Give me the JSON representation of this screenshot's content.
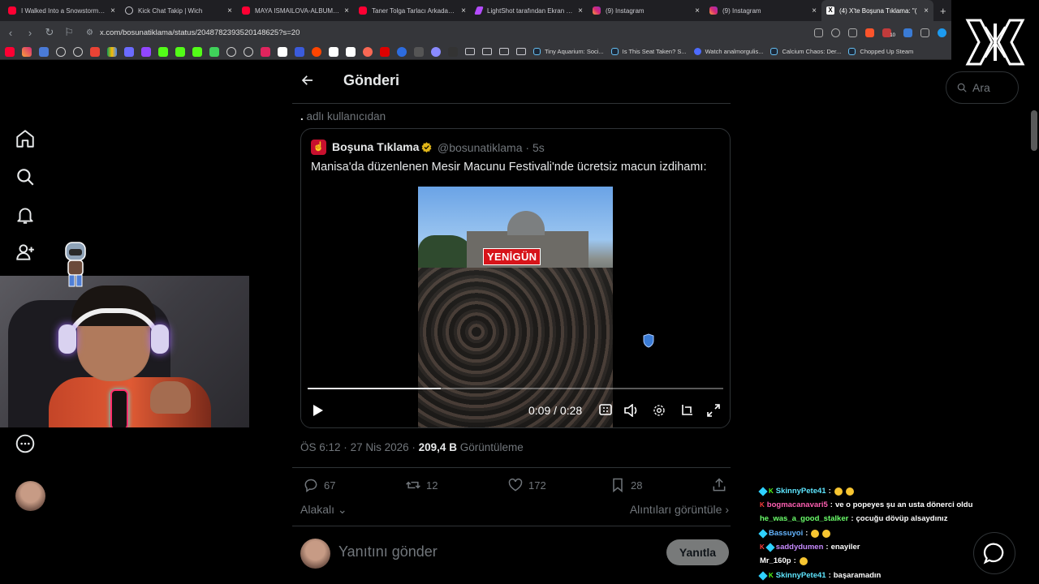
{
  "browser": {
    "tabs": [
      {
        "title": "I Walked Into a Snowstorm Wi",
        "icon": "youtube-icon"
      },
      {
        "title": "Kick Chat Takip | Wich",
        "icon": "globe-icon"
      },
      {
        "title": "MAYA ISMAILOVA-ALBUM \"TAI",
        "icon": "youtube-icon"
      },
      {
        "title": "Taner Tolga Tarlacı Arkadaşı Ya",
        "icon": "youtube-icon"
      },
      {
        "title": "LightShot tarafından Ekran Gö",
        "icon": "lightshot-icon"
      },
      {
        "title": "(9) Instagram",
        "icon": "instagram-icon"
      },
      {
        "title": "(9) Instagram",
        "icon": "instagram-icon"
      },
      {
        "title": "(4) X'te Boşuna Tıklama: \"(",
        "icon": "x-icon"
      }
    ],
    "new_tab": "+",
    "url": "x.com/bosunatiklama/status/2048782393520148625?s=20",
    "bookmarks": [
      {
        "label": "Tiny Aquarium: Soci..."
      },
      {
        "label": "Is This Seat Taken? S..."
      },
      {
        "label": "Watch analmorgulis..."
      },
      {
        "label": "Calcium Chaos: Der..."
      },
      {
        "label": "Chopped Up Steam"
      }
    ],
    "ext_badge": "10"
  },
  "page": {
    "title": "Gönderi",
    "by_user_prefix": ".",
    "by_user_suffix": "adlı kullanıcıdan",
    "search_placeholder": "Ara"
  },
  "quote": {
    "name": "Boşuna Tıklama",
    "handle": "@bosunatiklama",
    "time": "· 5s",
    "text": "Manisa'da düzenlenen Mesir Macunu Festivali'nde ücretsiz macun izdihamı:",
    "video": {
      "watermark": "YENİGÜN",
      "current_time": "0:09",
      "separator": "/",
      "duration": "0:28",
      "progress": 0.32
    }
  },
  "post_meta": {
    "time": "ÖS 6:12",
    "date": "27 Nis 2026",
    "views": "209,4 B",
    "views_label": "Görüntüleme",
    "sep": "·"
  },
  "actions": {
    "replies": "67",
    "reposts": "12",
    "likes": "172",
    "bookmarks": "28"
  },
  "sort": {
    "left": "Alakalı",
    "right": "Alıntıları görüntüle"
  },
  "reply": {
    "placeholder": "Yanıtını gönder",
    "button": "Yanıtla"
  },
  "chat": [
    {
      "user": "SkinnyPete41",
      "msg": "",
      "color": "#5ee6ff",
      "badges": [
        "gem",
        "kick-green"
      ],
      "emojis": 2
    },
    {
      "user": "bogmacanavari5",
      "msg": "ve o popeyes şu an usta dönerci oldu",
      "color": "#ff5fb2",
      "badges": [
        "kick-red"
      ],
      "emojis": 0
    },
    {
      "user": "he_was_a_good_stalker",
      "msg": "çocuğu dövüp alsaydınız",
      "color": "#6bff6b",
      "badges": [],
      "emojis": 0
    },
    {
      "user": "Bassuyoi",
      "msg": "",
      "color": "#64b5ff",
      "badges": [
        "gem"
      ],
      "emojis": 2
    },
    {
      "user": "saddydumen",
      "msg": "enayiler",
      "color": "#c78bff",
      "badges": [
        "kick-red",
        "gem"
      ],
      "emojis": 0
    },
    {
      "user": "Mr_160p",
      "msg": "",
      "color": "#ffffff",
      "badges": [],
      "emojis": 1
    },
    {
      "user": "SkinnyPete41",
      "msg": "başaramadın",
      "color": "#5ee6ff",
      "badges": [
        "gem",
        "kick-green"
      ],
      "emojis": 0
    }
  ],
  "colors": {
    "background": "#000000",
    "text_primary": "#e7e9ea",
    "text_secondary": "#71767b",
    "border": "#2f3336",
    "verified_gold": "#e2b719",
    "brand_red": "#c8102e"
  }
}
